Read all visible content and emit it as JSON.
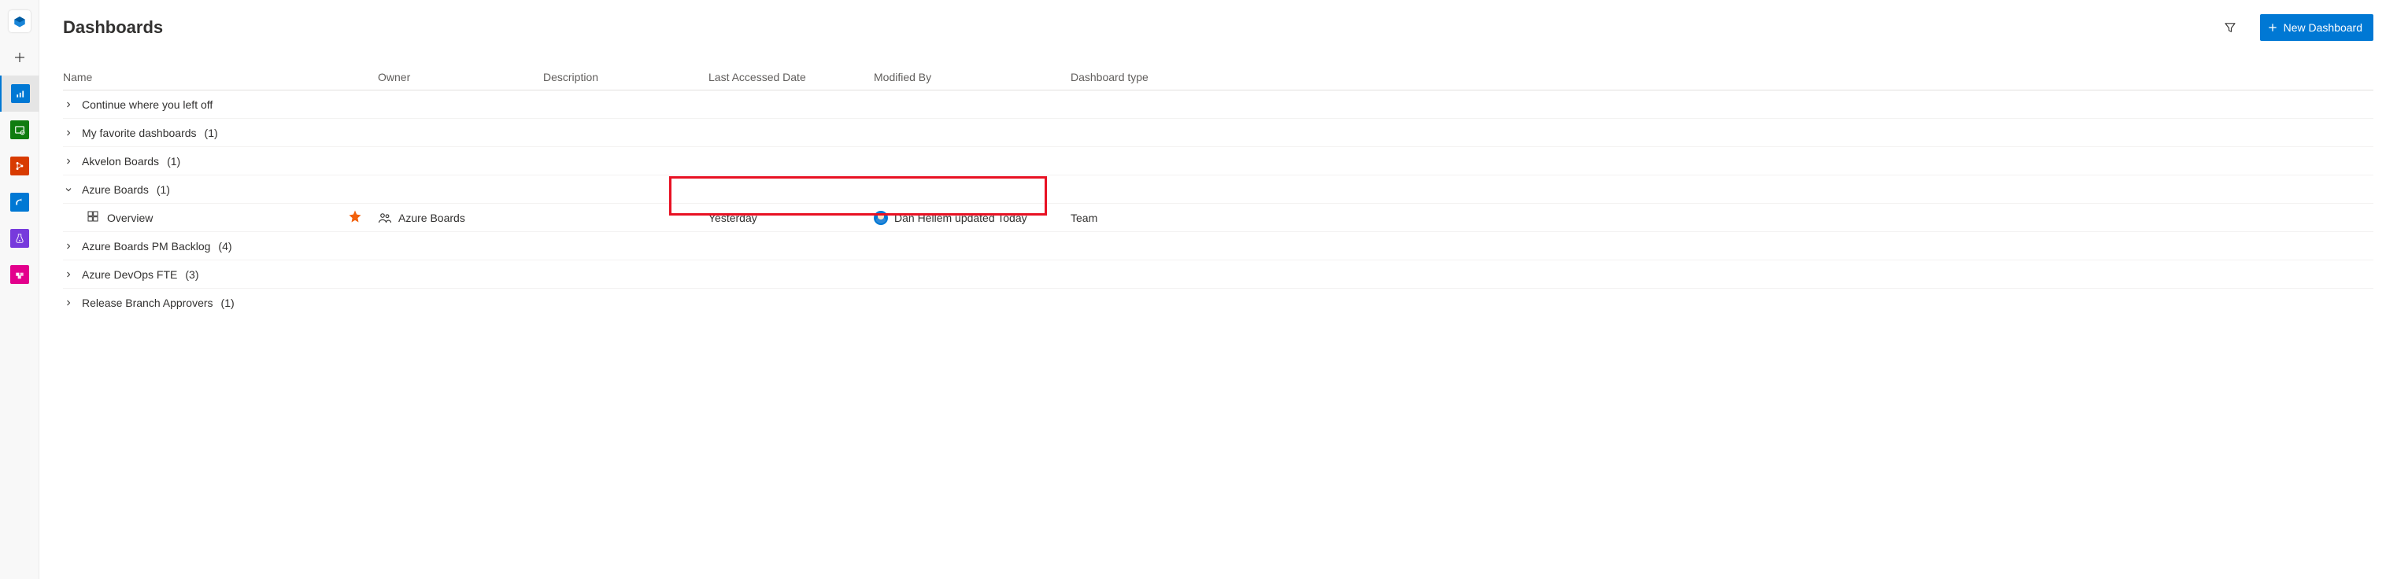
{
  "header": {
    "title": "Dashboards",
    "new_button_label": "New Dashboard"
  },
  "columns": {
    "name": "Name",
    "owner": "Owner",
    "description": "Description",
    "last_accessed": "Last Accessed Date",
    "modified_by": "Modified By",
    "type": "Dashboard type"
  },
  "groups": [
    {
      "label": "Continue where you left off",
      "count": "",
      "expanded": false
    },
    {
      "label": "My favorite dashboards",
      "count": "(1)",
      "expanded": false
    },
    {
      "label": "Akvelon Boards",
      "count": "(1)",
      "expanded": false
    },
    {
      "label": "Azure Boards",
      "count": "(1)",
      "expanded": true,
      "children": [
        {
          "name": "Overview",
          "favorite": true,
          "owner": "Azure Boards",
          "description": "",
          "last_accessed": "Yesterday",
          "modified_by": "Dan Hellem updated Today",
          "type": "Team"
        }
      ]
    },
    {
      "label": "Azure Boards PM Backlog",
      "count": "(4)",
      "expanded": false
    },
    {
      "label": "Azure DevOps FTE",
      "count": "(3)",
      "expanded": false
    },
    {
      "label": "Release Branch Approvers",
      "count": "(1)",
      "expanded": false
    }
  ],
  "sidebar": {
    "items": [
      {
        "name": "logo",
        "color": "#0078d4"
      },
      {
        "name": "add",
        "color": "#323130"
      },
      {
        "name": "overview",
        "color": "#0078d4",
        "active": true
      },
      {
        "name": "boards",
        "color": "#107c10"
      },
      {
        "name": "repos",
        "color": "#d83b01"
      },
      {
        "name": "pipelines",
        "color": "#0078d4"
      },
      {
        "name": "test-plans",
        "color": "#773adc"
      },
      {
        "name": "artifacts",
        "color": "#e3008c"
      }
    ]
  },
  "highlight_note": "red annotation box around Last Accessed Date and Modified By cells of Overview row"
}
